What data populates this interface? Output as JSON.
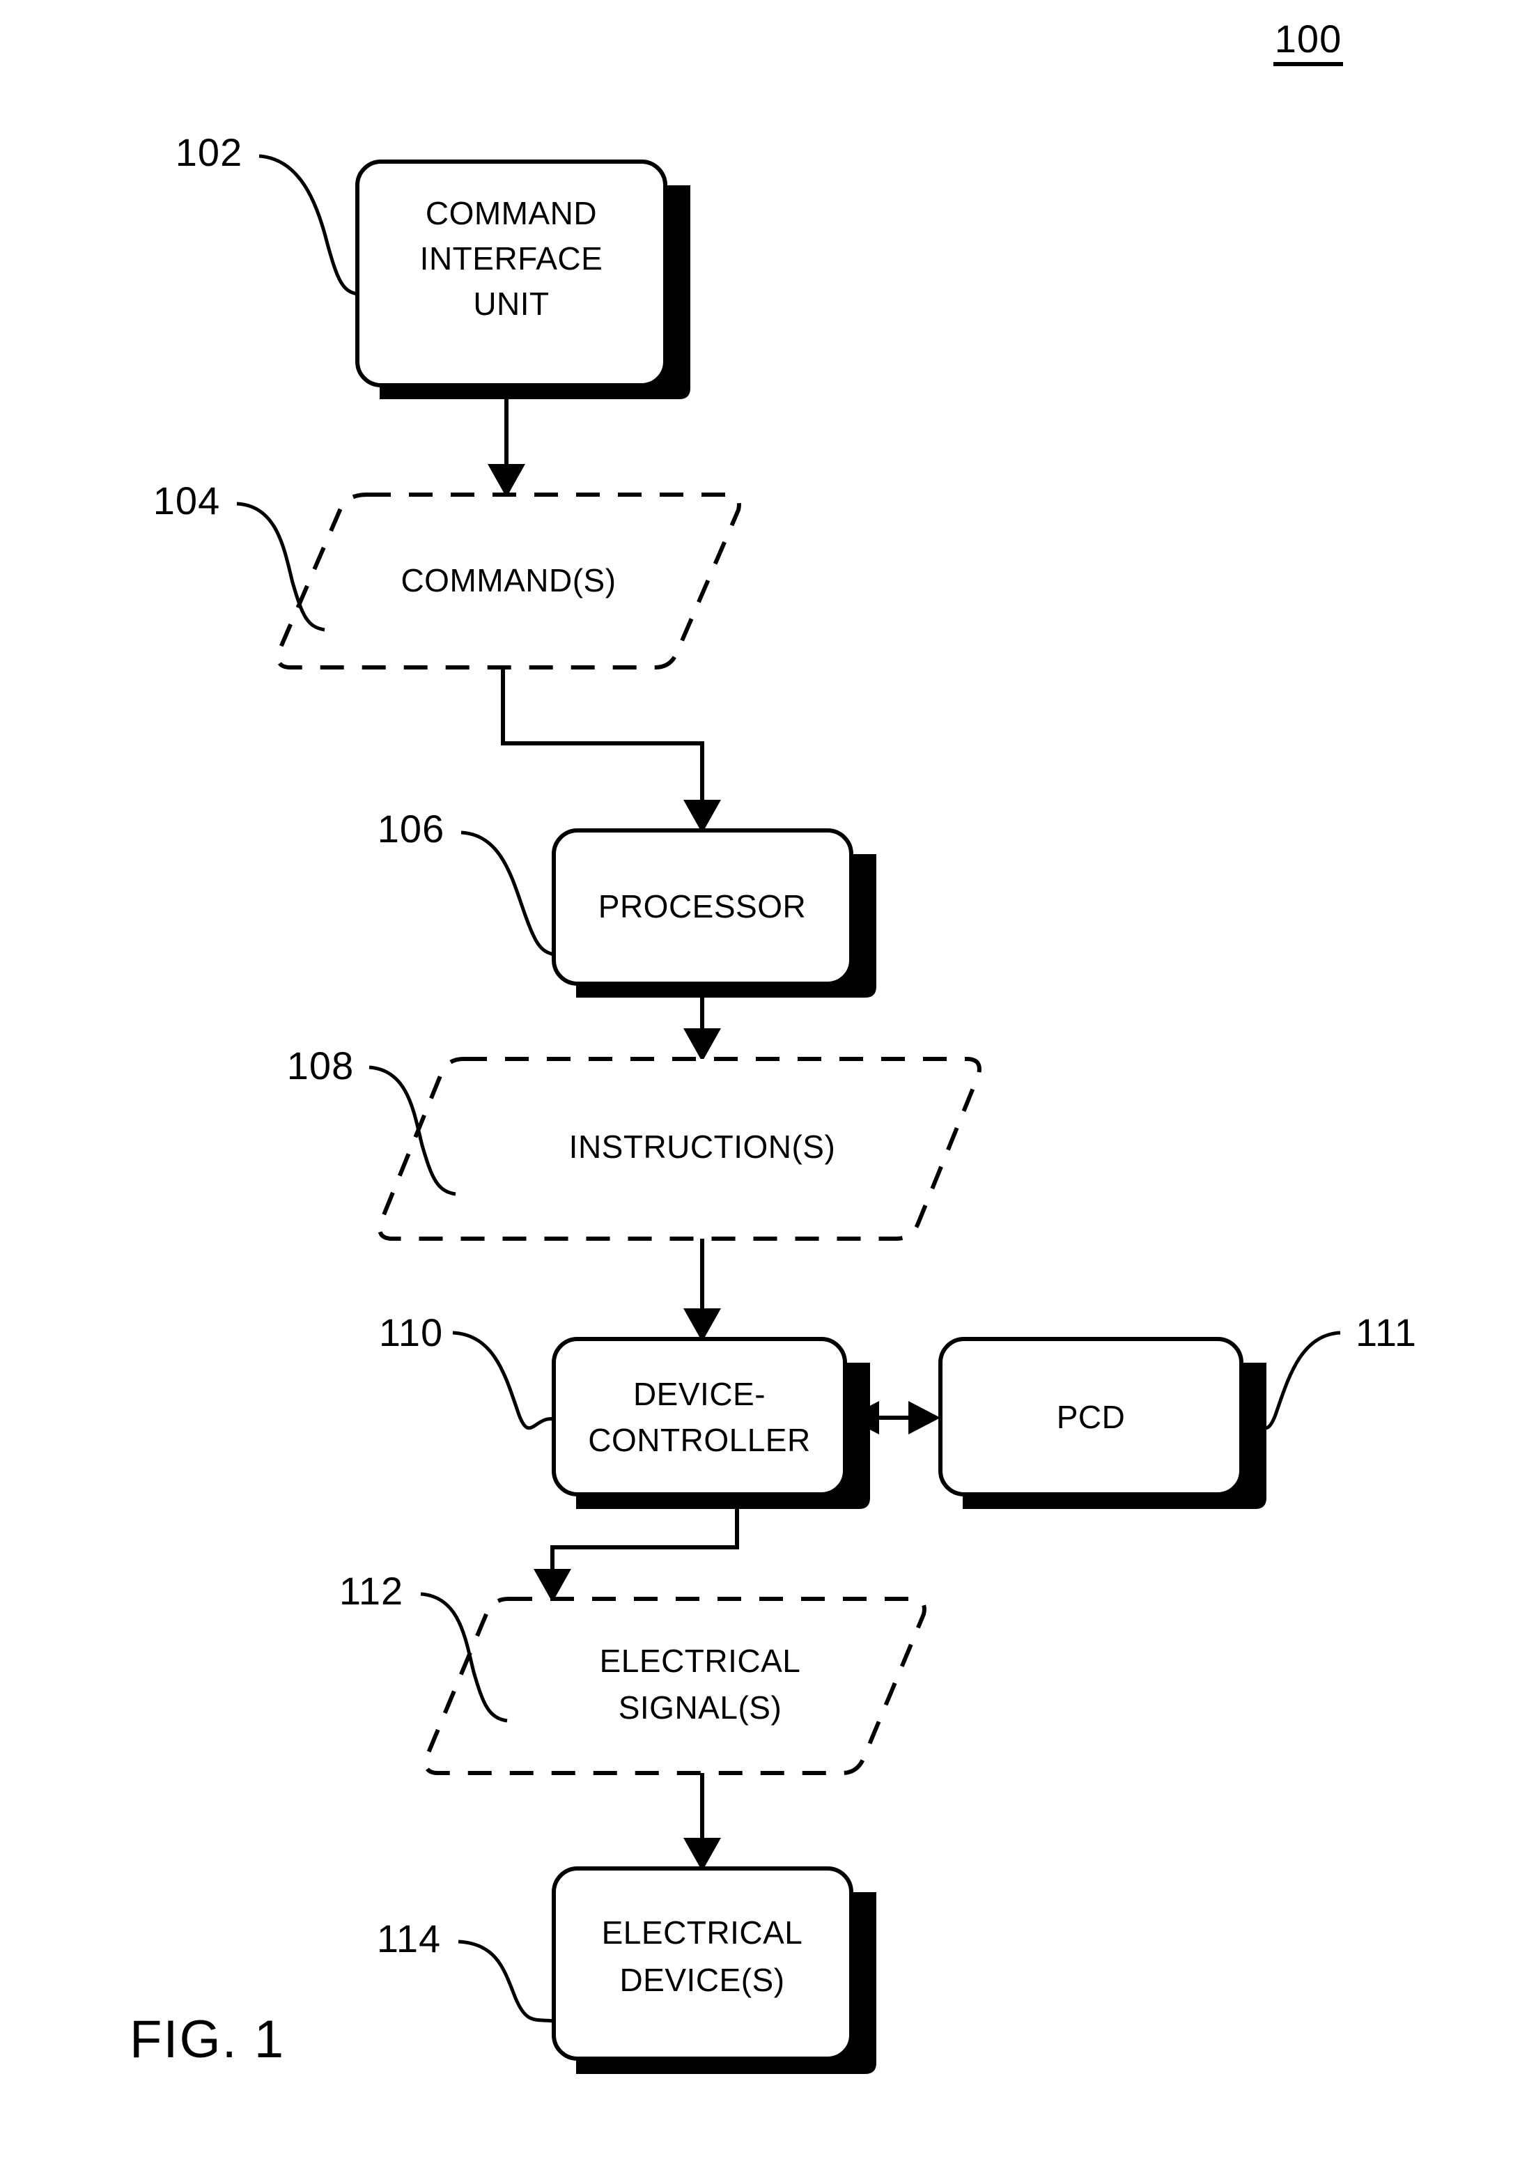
{
  "figure": {
    "caption": "FIG. 1",
    "system_reference": "100"
  },
  "nodes": [
    {
      "id": "command-interface-unit",
      "shape": "rounded-rect",
      "ref": "102",
      "lines": [
        "COMMAND",
        "INTERFACE",
        "UNIT"
      ]
    },
    {
      "id": "commands",
      "shape": "parallelogram-dashed",
      "ref": "104",
      "lines": [
        "COMMAND(S)"
      ]
    },
    {
      "id": "processor",
      "shape": "rounded-rect",
      "ref": "106",
      "lines": [
        "PROCESSOR"
      ]
    },
    {
      "id": "instructions",
      "shape": "parallelogram-dashed",
      "ref": "108",
      "lines": [
        "INSTRUCTION(S)"
      ]
    },
    {
      "id": "device-controller",
      "shape": "rounded-rect",
      "ref": "110",
      "lines": [
        "DEVICE-",
        "CONTROLLER"
      ]
    },
    {
      "id": "pcd",
      "shape": "rounded-rect",
      "ref": "111",
      "lines": [
        "PCD"
      ]
    },
    {
      "id": "electrical-signals",
      "shape": "parallelogram-dashed",
      "ref": "112",
      "lines": [
        "ELECTRICAL",
        "SIGNAL(S)"
      ]
    },
    {
      "id": "electrical-devices",
      "shape": "rounded-rect",
      "ref": "114",
      "lines": [
        "ELECTRICAL",
        "DEVICE(S)"
      ]
    }
  ],
  "text": {
    "command_interface_unit_l1": "COMMAND",
    "command_interface_unit_l2": "INTERFACE",
    "command_interface_unit_l3": "UNIT",
    "commands": "COMMAND(S)",
    "processor": "PROCESSOR",
    "instructions": "INSTRUCTION(S)",
    "device_controller_l1": "DEVICE-",
    "device_controller_l2": "CONTROLLER",
    "pcd": "PCD",
    "electrical_signals_l1": "ELECTRICAL",
    "electrical_signals_l2": "SIGNAL(S)",
    "electrical_devices_l1": "ELECTRICAL",
    "electrical_devices_l2": "DEVICE(S)"
  },
  "refs": {
    "system": "100",
    "command_interface_unit": "102",
    "commands": "104",
    "processor": "106",
    "instructions": "108",
    "device_controller": "110",
    "pcd": "111",
    "electrical_signals": "112",
    "electrical_devices": "114"
  },
  "connections": [
    {
      "id": "ciu-to-commands",
      "from": "command-interface-unit",
      "to": "commands",
      "style": "arrow-down"
    },
    {
      "id": "commands-to-processor",
      "from": "commands",
      "to": "processor",
      "style": "elbow-arrow-down"
    },
    {
      "id": "processor-to-instructions",
      "from": "processor",
      "to": "instructions",
      "style": "arrow-down"
    },
    {
      "id": "instructions-to-device-controller",
      "from": "instructions",
      "to": "device-controller",
      "style": "arrow-down"
    },
    {
      "id": "device-controller-pcd",
      "from": "device-controller",
      "to": "pcd",
      "style": "double-arrow-horizontal"
    },
    {
      "id": "pcd-to-electrical-signals",
      "from": "pcd",
      "to": "electrical-signals",
      "style": "elbow-arrow-down"
    },
    {
      "id": "electrical-signals-to-devices",
      "from": "electrical-signals",
      "to": "electrical-devices",
      "style": "arrow-down"
    }
  ],
  "colors": {
    "stroke": "#000000",
    "fill": "#ffffff",
    "shadow": "#000000"
  }
}
